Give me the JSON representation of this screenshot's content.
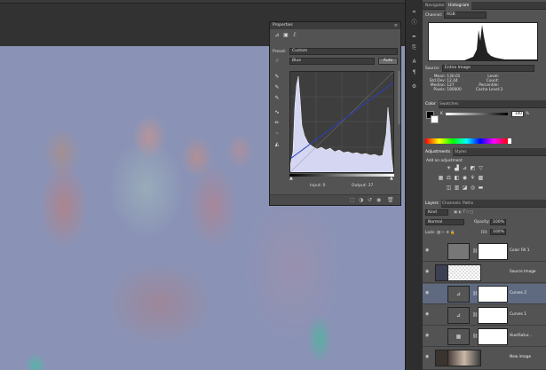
{
  "properties": {
    "title": "Properties",
    "preset_label": "Preset:",
    "preset_value": "Custom",
    "channel_value": "Blue",
    "auto_label": "Auto",
    "input_label": "Input: 0",
    "output_label": "Output: 37"
  },
  "histogram": {
    "tabs": [
      "Navigator",
      "Histogram"
    ],
    "channel_label": "Channel:",
    "channel_value": "RGB",
    "source_label": "Source:",
    "source_value": "Entire Image",
    "stats_left": [
      {
        "label": "Mean:",
        "value": "130.01"
      },
      {
        "label": "Std Dev:",
        "value": "12.44"
      },
      {
        "label": "Median:",
        "value": "127"
      },
      {
        "label": "Pixels:",
        "value": "180000"
      }
    ],
    "stats_right": [
      {
        "label": "Level:",
        "value": ""
      },
      {
        "label": "Count:",
        "value": ""
      },
      {
        "label": "Percentile:",
        "value": ""
      },
      {
        "label": "Cache Level:",
        "value": "3"
      }
    ]
  },
  "color": {
    "tabs": [
      "Color",
      "Swatches"
    ],
    "k_label": "K",
    "k_value": "100",
    "k_unit": "%"
  },
  "adjustments": {
    "tabs": [
      "Adjustments",
      "Styles"
    ],
    "add_label": "Add an adjustment"
  },
  "layers": {
    "tabs": [
      "Layers",
      "Channels",
      "Paths"
    ],
    "kind_label": "Kind",
    "blend_mode": "Normal",
    "opacity_label": "Opacity:",
    "opacity_value": "100%",
    "lock_label": "Lock:",
    "fill_label": "Fill:",
    "fill_value": "100%",
    "items": [
      {
        "name": "Color Fill 1"
      },
      {
        "name": "Source Image"
      },
      {
        "name": "Curves 2"
      },
      {
        "name": "Curves 1"
      },
      {
        "name": "Hue/Satur..."
      },
      {
        "name": "New image"
      }
    ]
  },
  "colors": {
    "panel_bg": "#535353",
    "active_layer": "#5f6a80",
    "canvas_tint": "#8a93b6",
    "curve_fill": "#d4d6f2",
    "curve_line": "#2a3fbf"
  }
}
